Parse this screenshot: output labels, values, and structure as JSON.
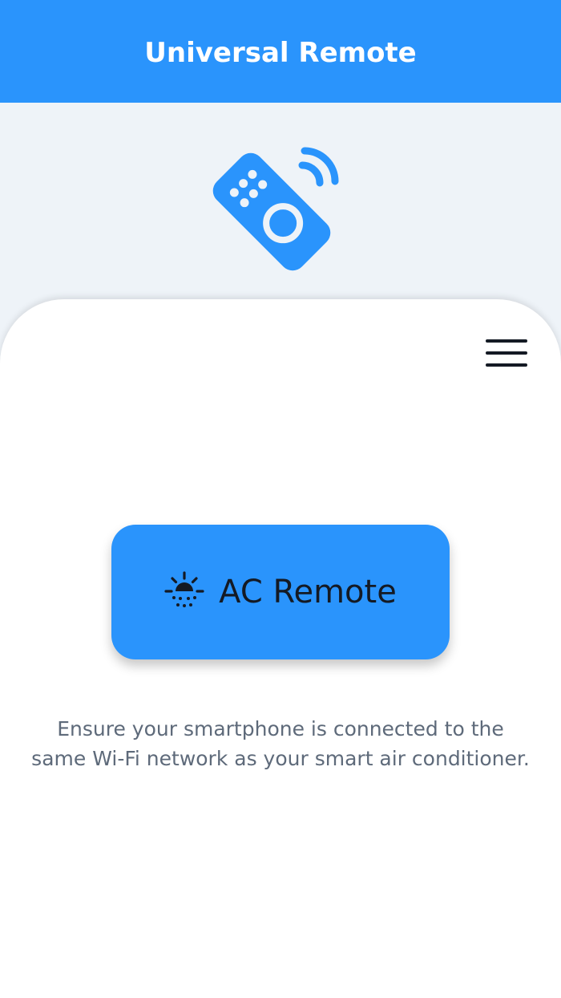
{
  "header": {
    "title": "Universal Remote"
  },
  "hero": {
    "icon": "remote-control-icon"
  },
  "panel": {
    "menu_icon": "hamburger-menu-icon",
    "ac_button": {
      "label": "AC Remote",
      "icon": "sun-icon"
    },
    "hint_line1": "Ensure your smartphone is connected to the",
    "hint_line2": "same Wi-Fi network as your smart air conditioner."
  },
  "colors": {
    "primary": "#2a94fc",
    "background": "#eef3f8",
    "panel": "#ffffff",
    "text_dark": "#141a24",
    "text_muted": "#5e6a7a"
  }
}
